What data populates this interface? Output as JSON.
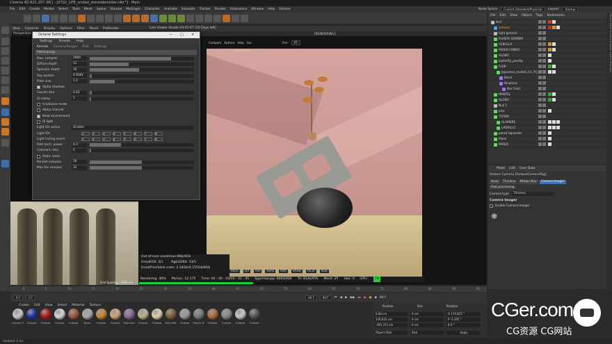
{
  "titlebar": "Cinema 4D R21.207 (RC) - [0702_LIFE_smiled_stereodensider.c4d *] - Main",
  "menubar": {
    "items": [
      "File",
      "Edit",
      "Create",
      "Modes",
      "Select",
      "Tools",
      "Mesh",
      "Spline",
      "Volume",
      "MoGraph",
      "Character",
      "Animate",
      "Simulate",
      "Tracker",
      "Render",
      "Extensions",
      "Window",
      "Help",
      "Octane"
    ],
    "node_space_label": "Node Space:",
    "node_space_value": "Current (Standard/Physical)",
    "layout_label": "Layout:",
    "layout_value": "Startup"
  },
  "viewport": {
    "menu": [
      "View",
      "Cameras",
      "Display",
      "Options",
      "Filter",
      "Panel",
      "ProRender"
    ],
    "center_label": "Live Viewer Studio V4.05-R7 (20 Days left)",
    "perspective_tab": "Perspective",
    "render_label": "[RENDERING]",
    "render_top": [
      "Compare",
      "Options",
      "Help",
      "Gui"
    ],
    "channel_label": "Chn:",
    "channel_value": "PT",
    "scene_tag": "04 bCamera",
    "grid_spacing": "Grid Spacing : 1000 cm"
  },
  "octane_window": {
    "title": "Octane Settings",
    "menu": [
      "Settings",
      "Presets",
      "Help"
    ],
    "tabs": [
      "Kernels",
      "Camera/Imager",
      "Post",
      "Settings"
    ],
    "kernel": "Pathtracing",
    "params": [
      {
        "label": "Max. samples",
        "value": "2000",
        "fill": 0.78
      },
      {
        "label": "Diffuse depth",
        "value": "12",
        "fill": 0.37
      },
      {
        "label": "Specular depth",
        "value": "16",
        "fill": 0.47
      },
      {
        "label": "Ray epsilon",
        "value": "0.0001",
        "fill": 0.02
      },
      {
        "label": "Filter size",
        "value": "1.2",
        "fill": 0.24
      }
    ],
    "alpha_shadows": "Alpha shadows",
    "caustic_blur": {
      "label": "Caustic blur",
      "value": "0.02",
      "fill": 0.02
    },
    "gi_clamp": {
      "label": "GI clamp",
      "value": "1",
      "fill": 0.01
    },
    "checks": [
      {
        "label": "Irradiance mode",
        "on": false
      },
      {
        "label": "Alpha channel",
        "on": false
      },
      {
        "label": "Keep environment",
        "on": true
      },
      {
        "label": "AI light",
        "on": false
      }
    ],
    "light_ids_action": {
      "label": "Light IDs action",
      "value": "Disable"
    },
    "light_ids": "Light IDs",
    "light_linking": "Light linking invert",
    "light_id_numbers": [
      "1",
      "2",
      "3",
      "4",
      "5",
      "6",
      "7",
      "8"
    ],
    "path_term_power": {
      "label": "Path term. power",
      "value": "0.3",
      "fill": 0.3
    },
    "coherent_ratio": {
      "label": "Coherent ratio",
      "value": "0",
      "fill": 0.0
    },
    "static_noise": "Static noise",
    "parallel_samples": {
      "label": "Parallel samples",
      "value": "16",
      "fill": 0.5
    },
    "max_tile_samples": {
      "label": "Max tile samples",
      "value": "32",
      "fill": 0.5
    }
  },
  "stats": {
    "line1": "Out-of-core used/max:0Kb/4Gb",
    "line2": "Grey8/16: 3/1",
    "line2b": "Rgb32/64: 13/5",
    "line3": "Used/free/total vram: 2.34Gb/4.155Gb/8Gb"
  },
  "render_tabs": [
    "Main",
    "Dif",
    "Ref",
    "RefD",
    "Refl",
    "Shdw",
    "OCol",
    "Post"
  ],
  "statusbar": {
    "rendering": "Rendering: 40%",
    "ms": "Ms/sec: 12.175",
    "time": "Time: 00 : 00 : 43/00 : 01 : 45",
    "spp": "Spp/maxspp: 800/2000",
    "tri": "Tri: 814k/97k",
    "mesh": "Mesh: 25",
    "hair": "Hair: 0",
    "gpu": "GPU:",
    "gpu_val": "74",
    "progress": 0.4
  },
  "timeline": {
    "ticks": [
      "0",
      "5",
      "10",
      "15",
      "20",
      "25",
      "30",
      "35",
      "40",
      "45",
      "50",
      "55",
      "60",
      "65",
      "70",
      "75",
      "80",
      "85",
      "90",
      "95"
    ],
    "frame": "90 F",
    "start": "0 F",
    "current": "0 F",
    "end": "90 F",
    "end2": "90 F"
  },
  "materials": {
    "menu": [
      "Create",
      "Edit",
      "View",
      "Select",
      "Material",
      "Texture"
    ],
    "items": [
      {
        "name": "Octane S",
        "color": "#c9c9c9"
      },
      {
        "name": "Octane",
        "color": "#2233aa"
      },
      {
        "name": "Octane",
        "color": "#b01818"
      },
      {
        "name": "Octane",
        "color": "#d8d8d8"
      },
      {
        "name": "Octane",
        "color": "#9a5a3a"
      },
      {
        "name": "None",
        "color": "#aaaaaa"
      },
      {
        "name": "Octane",
        "color": "#c7852e"
      },
      {
        "name": "Octane",
        "color": "#c9a878"
      },
      {
        "name": "Titanium",
        "color": "#8a6a9a"
      },
      {
        "name": "Octane",
        "color": "#c0b090"
      },
      {
        "name": "Octane",
        "color": "#e0d0b0"
      },
      {
        "name": "Hair Mat",
        "color": "#7a6040"
      },
      {
        "name": "Octane",
        "color": "#999999"
      },
      {
        "name": "Plastic B",
        "color": "#7a7a7a"
      },
      {
        "name": "Octane",
        "color": "#b06a3a"
      },
      {
        "name": "Octane",
        "color": "#888888"
      },
      {
        "name": "Octane",
        "color": "#c8c8c8"
      },
      {
        "name": "Octane",
        "color": "#555555"
      }
    ]
  },
  "coords": {
    "headers": [
      "Position",
      "Size",
      "Rotation"
    ],
    "rows": [
      {
        "axis": "X",
        "pos": "6.84 cm",
        "size": "0 cm",
        "rot": "H 179.815 °"
      },
      {
        "axis": "Y",
        "pos": "128.832 cm",
        "size": "0 cm",
        "rot": "P -5.305 °"
      },
      {
        "axis": "Z",
        "pos": "-395.373 cm",
        "size": "0 cm",
        "rot": "B 0 °"
      }
    ],
    "mode": "Object (Rel)",
    "size_mode": "Size",
    "apply": "Apply"
  },
  "bottom_status": "Updated: 0 ms.",
  "object_manager": {
    "menu": [
      "File",
      "Edit",
      "View",
      "Object",
      "Tags",
      "Bookmarks"
    ],
    "items": [
      {
        "name": "Null",
        "color": "#bbbbbb",
        "indent": 0,
        "tags": [
          "#d33",
          "#ddd"
        ]
      },
      {
        "name": "camera",
        "color": "#5a9adf",
        "indent": 1,
        "tags": [
          "#c32",
          "#c93",
          "#ddd"
        ]
      },
      {
        "name": "light general",
        "color": "#bbbbbb",
        "indent": 1,
        "tags": []
      },
      {
        "name": "PLANTA SOMBRA",
        "color": "#6bd16b",
        "indent": 1,
        "tags": []
      },
      {
        "name": "CEBOLLA",
        "color": "#6bd16b",
        "indent": 1,
        "tags": [
          "#c93",
          "#ddd"
        ]
      },
      {
        "name": "PARED FONDO",
        "color": "#6bd16b",
        "indent": 1,
        "tags": [
          "#c93",
          "#ddd"
        ]
      },
      {
        "name": "GLOBO",
        "color": "#6bd16b",
        "indent": 1,
        "tags": [
          "#ddd"
        ]
      },
      {
        "name": "butterfly_pendiq",
        "color": "#6bd16b",
        "indent": 1,
        "tags": [
          "#ddd"
        ]
      },
      {
        "name": "FLOR",
        "color": "#6bd16b",
        "indent": 1,
        "tags": [
          "#3a3",
          "#ddd"
        ]
      },
      {
        "name": "Japanese_models_k3_70_3?",
        "color": "#6bd16b",
        "indent": 2,
        "tags": [
          "#ddd",
          "#ddd"
        ]
      },
      {
        "name": "Bend",
        "color": "#9a7ae0",
        "indent": 3,
        "tags": []
      },
      {
        "name": "Displacer",
        "color": "#9a7ae0",
        "indent": 3,
        "tags": []
      },
      {
        "name": "Box Field",
        "color": "#9a7ae0",
        "indent": 4,
        "tags": []
      },
      {
        "name": "MANTEL",
        "color": "#6bd16b",
        "indent": 1,
        "tags": [
          "#3a3",
          "#ddd"
        ]
      },
      {
        "name": "GLOBO",
        "color": "#6bd16b",
        "indent": 1,
        "tags": [
          "#3a3",
          "#ddd"
        ]
      },
      {
        "name": "Null 1",
        "color": "#bbbbbb",
        "indent": 1,
        "tags": []
      },
      {
        "name": "piso",
        "color": "#6bd16b",
        "indent": 1,
        "tags": [
          "#ddd"
        ]
      },
      {
        "name": "TOTEM",
        "color": "#6bd16b",
        "indent": 1,
        "tags": []
      },
      {
        "name": "ALAMBRE",
        "color": "#6bd16b",
        "indent": 2,
        "tags": [
          "#ddd",
          "#ddd",
          "#ddd"
        ]
      },
      {
        "name": "LADRILLO",
        "color": "#6bd16b",
        "indent": 2,
        "tags": [
          "#ddd",
          "#ddd",
          "#ddd"
        ]
      },
      {
        "name": "pared izquierda",
        "color": "#6bd16b",
        "indent": 1,
        "tags": [
          "#ddd"
        ]
      },
      {
        "name": "Plane",
        "color": "#6bd16b",
        "indent": 1,
        "tags": [
          "#ddd"
        ]
      },
      {
        "name": "PARED",
        "color": "#6bd16b",
        "indent": 1,
        "tags": [
          "#ddd"
        ]
      }
    ]
  },
  "attributes": {
    "menu": [
      "Mode",
      "Edit",
      "User Data"
    ],
    "title": "Octane Camera [OctaneCameraTag]",
    "tabs": [
      "Basic",
      "Thinlens",
      "Motion Blur",
      "Camera Imager"
    ],
    "selected_tab": "Camera Imager",
    "sub": "Post processing",
    "camera_type_label": "Camera type",
    "camera_type_value": "Thinlens",
    "section": "Camera Imager",
    "enable": "Enable Camera Imager"
  },
  "right_tabs": "Objects  Takes  Content Browser  Layers  Structure",
  "watermark": {
    "main": "CGer.com",
    "sub": "CG资源 CG网站"
  }
}
